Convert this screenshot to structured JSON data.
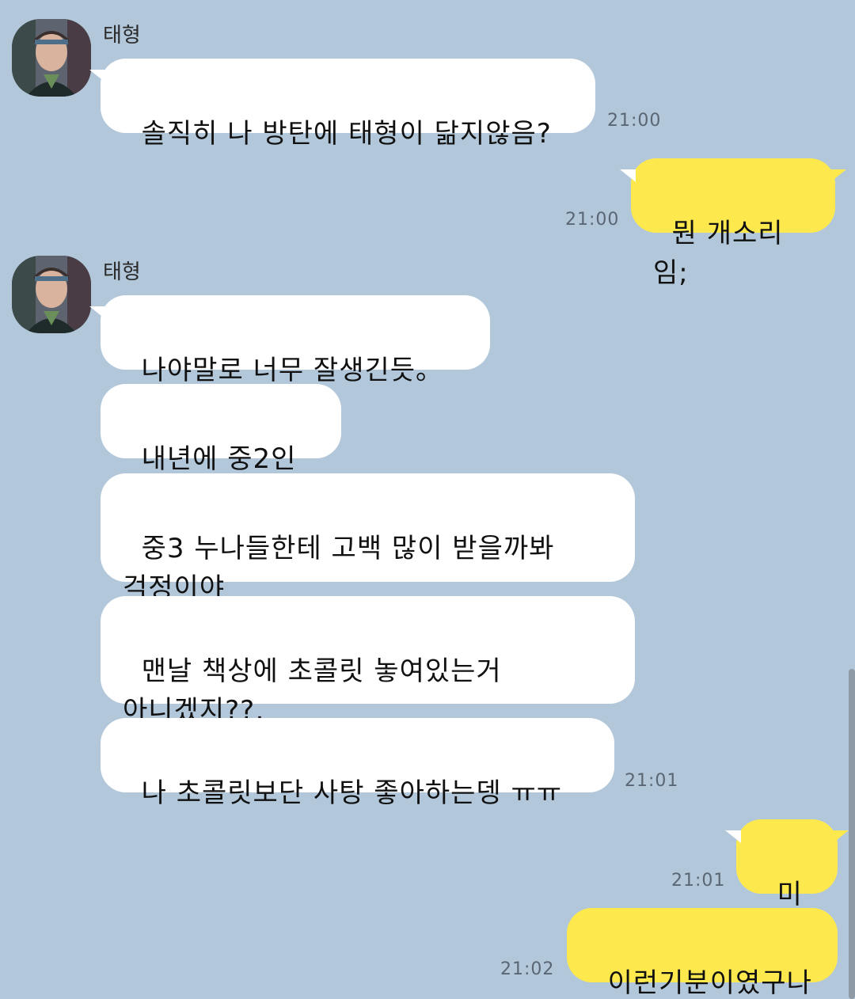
{
  "chat": {
    "contact_name": "태형",
    "messages": [
      {
        "from": "other",
        "text": "솔직히 나 방탄에 태형이 닮지않음?",
        "time": "21:00"
      },
      {
        "from": "me",
        "text": "뭔 개소리임;",
        "time": "21:00"
      },
      {
        "from": "other",
        "text": "나야말로 너무 잘생긴듯。ㅋ"
      },
      {
        "from": "other",
        "text": "내년에 중2인데"
      },
      {
        "from": "other",
        "text": "중3 누나들한테 고백 많이 받을까봐\n걱정이야"
      },
      {
        "from": "other",
        "text": "맨날 책상에 초콜릿 놓여있는거\n아니겠지??,"
      },
      {
        "from": "other",
        "text": "나 초콜릿보단 사탕 좋아하는뎅 ㅠㅠ",
        "time": "21:01"
      },
      {
        "from": "me",
        "text": "미안",
        "time": "21:01"
      },
      {
        "from": "me",
        "text": "이런기분이였구나",
        "time": "21:02"
      }
    ]
  },
  "colors": {
    "background": "#b2c7da",
    "my_bubble": "#fde94e",
    "other_bubble": "#ffffff"
  }
}
